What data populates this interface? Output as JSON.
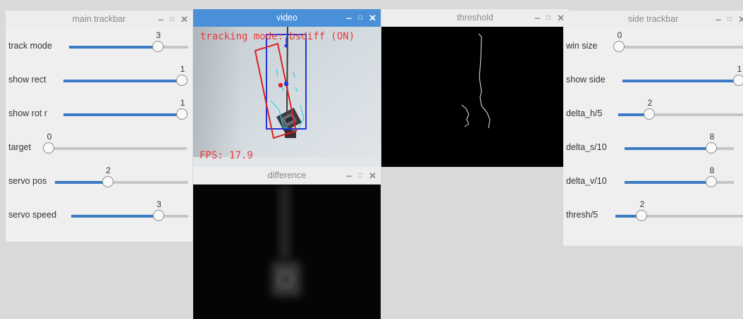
{
  "windows": {
    "main_trackbar": {
      "title": "main trackbar",
      "controls": [
        {
          "label": "track mode",
          "value": "3",
          "fraction": 0.75
        },
        {
          "label": "show rect",
          "value": "1",
          "fraction": 1.0
        },
        {
          "label": "show rot r",
          "value": "1",
          "fraction": 1.0
        },
        {
          "label": "target",
          "value": "0",
          "fraction": 0.0
        },
        {
          "label": "servo pos",
          "value": "2",
          "fraction": 0.4
        },
        {
          "label": "servo speed",
          "value": "3",
          "fraction": 0.75
        }
      ]
    },
    "video": {
      "title": "video",
      "mode_text": "tracking mode: bsdiff (ON)",
      "fps_text": "FPS: 17.9"
    },
    "difference": {
      "title": "difference"
    },
    "threshold": {
      "title": "threshold"
    },
    "side_trackbar": {
      "title": "side trackbar",
      "controls": [
        {
          "label": "win size",
          "value": "0",
          "fraction": 0.0
        },
        {
          "label": "show side",
          "value": "1",
          "fraction": 1.0
        },
        {
          "label": "delta_h/5",
          "value": "2",
          "fraction": 0.25
        },
        {
          "label": "delta_s/10",
          "value": "8",
          "fraction": 0.8
        },
        {
          "label": "delta_v/10",
          "value": "8",
          "fraction": 0.8
        },
        {
          "label": "thresh/5",
          "value": "2",
          "fraction": 0.2
        }
      ]
    }
  },
  "titlebar_buttons": {
    "minimize": "–",
    "maximize": "□",
    "close": "✕"
  },
  "colors": {
    "active_titlebar": "#4a90d9",
    "slider_fill": "#3b7bc4",
    "tracking_text": "#ea3a3a",
    "rect_blue": "#2233dd",
    "rect_red": "#dd2020",
    "contour_cyan": "#33d0e0"
  }
}
